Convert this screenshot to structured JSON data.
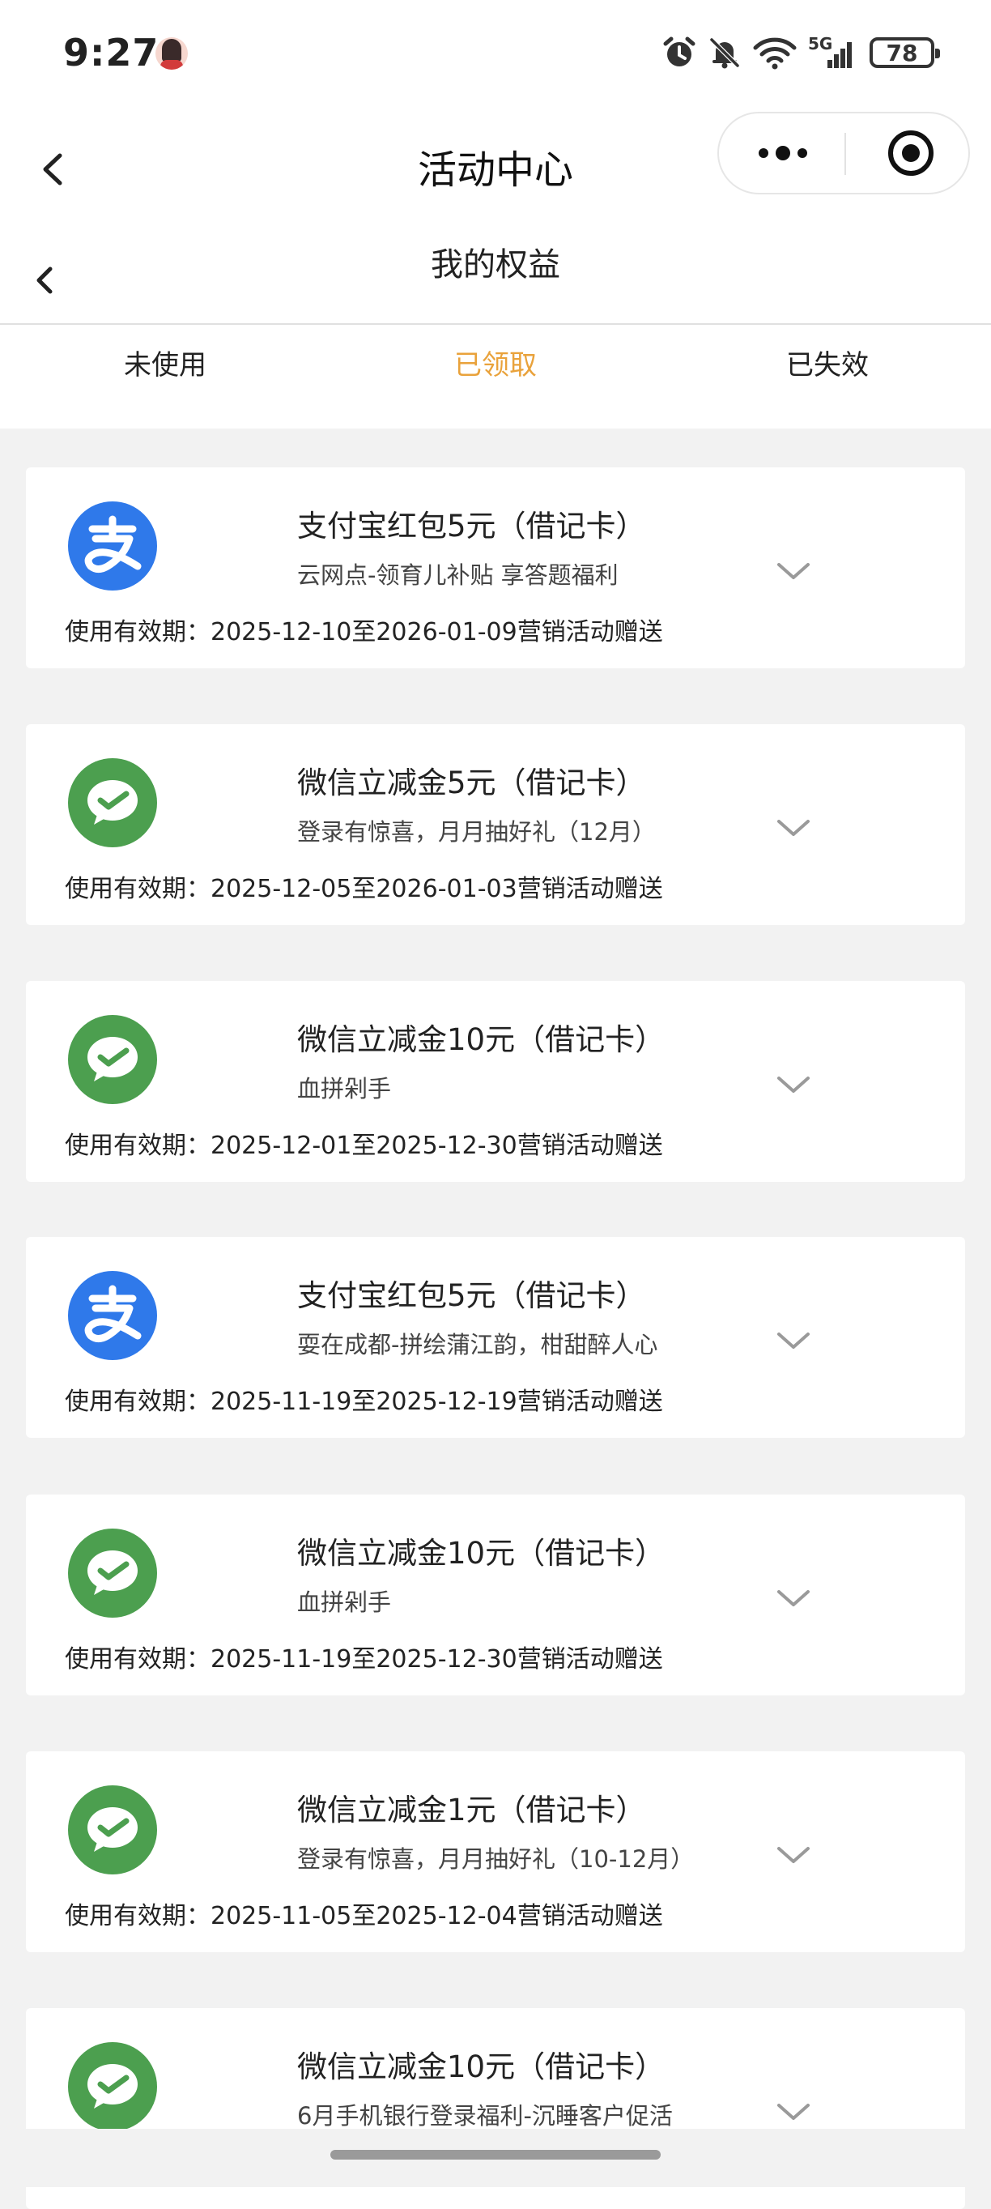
{
  "status_bar": {
    "time": "9:27",
    "network_label": "5G",
    "battery": "78",
    "icons": [
      "avatar",
      "alarm-icon",
      "mute-bell-icon",
      "wifi-icon",
      "signal-icon",
      "battery-icon"
    ]
  },
  "nav": {
    "title": "活动中心",
    "back_icon": "chevron-left-icon",
    "more_icon": "more-dots-icon",
    "close_icon": "target-circle-icon"
  },
  "page": {
    "title": "我的权益",
    "back_icon": "chevron-left-icon"
  },
  "tabs": [
    {
      "label": "未使用",
      "active": false
    },
    {
      "label": "已领取",
      "active": true
    },
    {
      "label": "已失效",
      "active": false
    }
  ],
  "colors": {
    "accent": "#e9a23b",
    "alipay": "#2f79ea",
    "wechat": "#4c9f4f",
    "background": "#f2f2f2"
  },
  "validity_prefix": "使用有效期：",
  "cards": [
    {
      "type": "alipay",
      "title": "支付宝红包5元（借记卡）",
      "subtitle": "云网点-领育儿补贴 享答题福利",
      "validity": "使用有效期：2025-12-10至2026-01-09营销活动赠送"
    },
    {
      "type": "wechat",
      "title": "微信立减金5元（借记卡）",
      "subtitle": "登录有惊喜，月月抽好礼（12月）",
      "validity": "使用有效期：2025-12-05至2026-01-03营销活动赠送"
    },
    {
      "type": "wechat",
      "title": "微信立减金10元（借记卡）",
      "subtitle": "血拼剁手",
      "validity": "使用有效期：2025-12-01至2025-12-30营销活动赠送"
    },
    {
      "type": "alipay",
      "title": "支付宝红包5元（借记卡）",
      "subtitle": "耍在成都-拼绘蒲江韵，柑甜醉人心",
      "validity": "使用有效期：2025-11-19至2025-12-19营销活动赠送"
    },
    {
      "type": "wechat",
      "title": "微信立减金10元（借记卡）",
      "subtitle": "血拼剁手",
      "validity": "使用有效期：2025-11-19至2025-12-30营销活动赠送"
    },
    {
      "type": "wechat",
      "title": "微信立减金1元（借记卡）",
      "subtitle": "登录有惊喜，月月抽好礼（10-12月）",
      "validity": "使用有效期：2025-11-05至2025-12-04营销活动赠送"
    },
    {
      "type": "wechat",
      "title": "微信立减金10元（借记卡）",
      "subtitle": "6月手机银行登录福利-沉睡客户促活",
      "validity": ""
    }
  ]
}
